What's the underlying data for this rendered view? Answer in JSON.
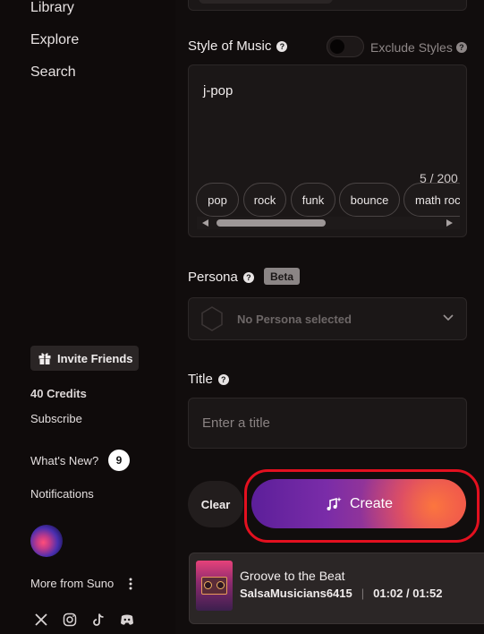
{
  "sidebar": {
    "nav": [
      "Library",
      "Explore",
      "Search"
    ],
    "invite_label": "Invite Friends",
    "credits": "40 Credits",
    "subscribe": "Subscribe",
    "whats_new": "What's New?",
    "whats_new_count": "9",
    "notifications": "Notifications",
    "more_from": "More from Suno"
  },
  "style": {
    "label": "Style of Music",
    "exclude_label": "Exclude Styles",
    "value": "j-pop",
    "counter": "5 / 200",
    "tags": [
      "pop",
      "rock",
      "funk",
      "bounce",
      "math roc"
    ]
  },
  "persona": {
    "label": "Persona",
    "beta": "Beta",
    "placeholder": "No Persona selected"
  },
  "title": {
    "label": "Title",
    "placeholder": "Enter a title"
  },
  "actions": {
    "clear": "Clear",
    "create": "Create"
  },
  "player": {
    "song": "Groove to the Beat",
    "artist": "SalsaMusicians6415",
    "separator": "|",
    "time": "01:02 / 01:52"
  },
  "colors": {
    "highlight": "#e3101f",
    "background": "#0f0b0b"
  }
}
